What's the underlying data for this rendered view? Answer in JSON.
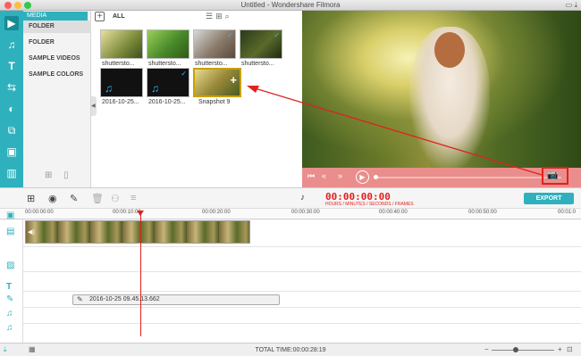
{
  "window": {
    "title": "Untitled - Wondershare Filmora"
  },
  "categories": {
    "header": "MEDIA",
    "items": [
      {
        "label": "FOLDER"
      },
      {
        "label": "FOLDER"
      },
      {
        "label": "SAMPLE VIDEOS"
      },
      {
        "label": "SAMPLE COLORS"
      }
    ]
  },
  "library": {
    "filter_label": "ALL",
    "thumbnails": [
      {
        "label": "shutterstо..."
      },
      {
        "label": "shutterstо..."
      },
      {
        "label": "shutterstо..."
      },
      {
        "label": "shutterstо..."
      },
      {
        "label": "2016-10-25..."
      },
      {
        "label": "2016-10-25..."
      },
      {
        "label": "Snapshot 9"
      }
    ]
  },
  "timeline": {
    "timecode": "00:00:00:00",
    "timecode_units": "HOURS / MINUTES / SECONDS / FRAMES",
    "export_label": "EXPORT",
    "ruler": [
      "00:00:00:00",
      "00:00:10:00",
      "00:00:20:00",
      "00:00:30:00",
      "00:00:40:00",
      "00:00:50:00",
      "00:01:0"
    ],
    "text_clip": "2016-10-25 09.45.13.662",
    "total_time": "TOTAL TIME:00:00:28:19"
  },
  "colors": {
    "accent": "#2eb1bd",
    "highlight_red": "#e2211d",
    "preview_bar": "#e98e8c"
  }
}
